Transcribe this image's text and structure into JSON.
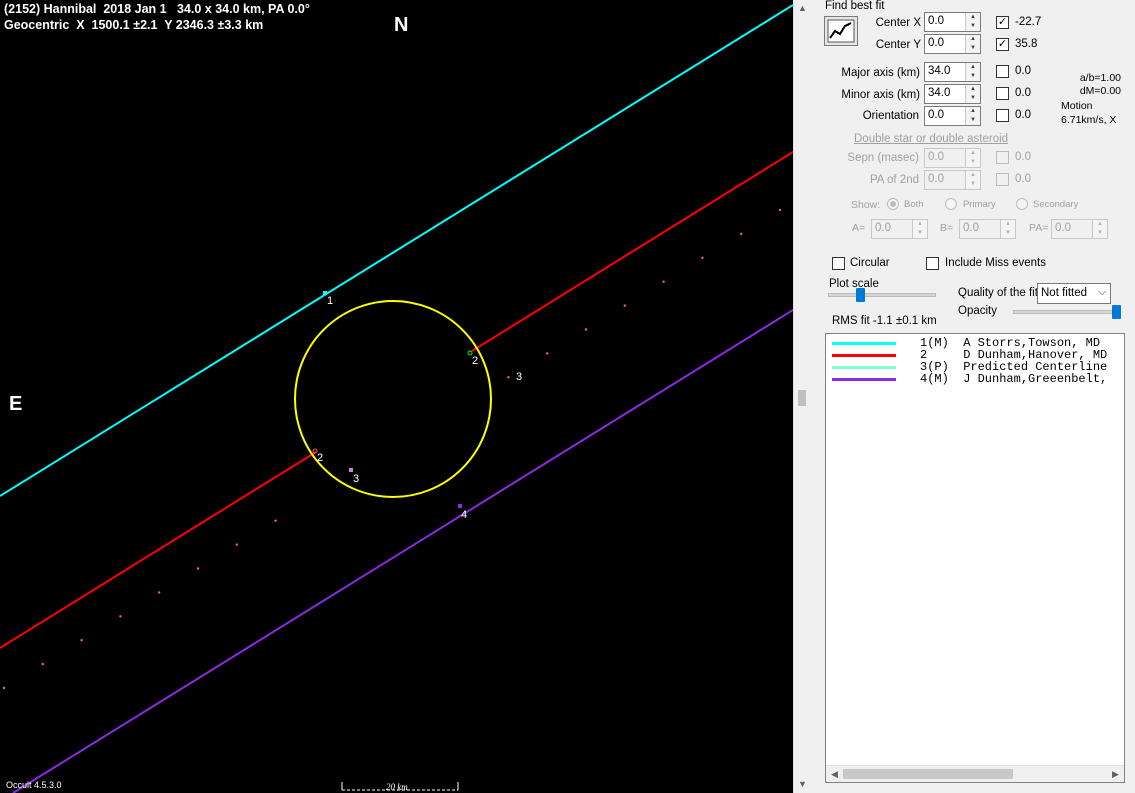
{
  "plot": {
    "title_line1": "(2152) Hannibal  2018 Jan 1   34.0 x 34.0 km, PA 0.0°",
    "title_line2": "Geocentric  X  1500.1 ±2.1  Y 2346.3 ±3.3 km",
    "north_label": "N",
    "east_label": "E",
    "version": "Occult 4.5.3.0",
    "scale_label": "20 km",
    "chord_labels": [
      "1",
      "2",
      "3",
      "2",
      "3",
      "4"
    ],
    "colors": {
      "chord1": "#00ffff",
      "chord2": "#ff0000",
      "chord4": "#8a2be2",
      "ellipse": "#ffff00",
      "predicted": "#ff6666",
      "background": "#000000"
    }
  },
  "panel": {
    "find_best_fit": "Find best fit",
    "center_x": {
      "label": "Center X",
      "value": "0.0",
      "checked": true,
      "result": "-22.7"
    },
    "center_y": {
      "label": "Center Y",
      "value": "0.0",
      "checked": true,
      "result": "35.8"
    },
    "major_axis": {
      "label": "Major axis (km)",
      "value": "34.0",
      "checked": false,
      "result": "0.0"
    },
    "minor_axis": {
      "label": "Minor axis (km)",
      "value": "34.0",
      "checked": false,
      "result": "0.0"
    },
    "orientation": {
      "label": "Orientation",
      "value": "0.0",
      "checked": false,
      "result": "0.0"
    },
    "ratio": "a/b=1.00",
    "dm": "dM=0.00",
    "motion_label": "Motion",
    "motion_value": "6.71km/s, X",
    "double_star": {
      "heading": "Double star  or  double asteroid",
      "sepn_label": "Sepn (masec)",
      "sepn_value": "0.0",
      "sepn_result": "0.0",
      "pa_label": "PA of 2nd",
      "pa_value": "0.0",
      "pa_result": "0.0",
      "show_label": "Show:",
      "show_options": [
        "Both",
        "Primary",
        "Secondary"
      ],
      "a_label": "A=",
      "a_value": "0.0",
      "b_label": "B=",
      "b_value": "0.0",
      "pa2_label": "PA=",
      "pa2_value": "0.0"
    },
    "circular_label": "Circular",
    "include_miss_label": "Include Miss events",
    "plot_scale_label": "Plot scale",
    "quality_label": "Quality of the fit",
    "quality_value": "Not fitted",
    "opacity_label": "Opacity",
    "rms_fit": "RMS fit -1.1 ±0.1 km",
    "legend": [
      {
        "text": "1(M)  A Storrs,Towson, MD",
        "color": "#00ffff"
      },
      {
        "text": "2     D Dunham,Hanover, MD",
        "color": "#ff0000"
      },
      {
        "text": "3(P)  Predicted Centerline",
        "color": "#80ffd0"
      },
      {
        "text": "4(M)  J Dunham,Greeenbelt,",
        "color": "#8a2be2"
      }
    ]
  }
}
